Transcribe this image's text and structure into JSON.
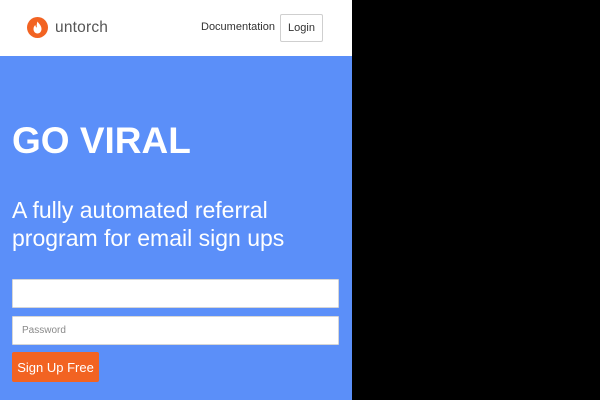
{
  "header": {
    "brand": "untorch",
    "documentation_link": "Documentation",
    "login_label": "Login",
    "logo_icon": "flame-icon"
  },
  "hero": {
    "headline": "GO VIRAL",
    "subheadline": "A fully automated referral program for email sign ups",
    "email_placeholder": "",
    "password_placeholder": "Password",
    "signup_label": "Sign Up Free"
  },
  "colors": {
    "accent": "#f26322",
    "hero_background": "#5b8ff9",
    "page_background": "#ffffff",
    "outside_viewport": "#000000"
  }
}
